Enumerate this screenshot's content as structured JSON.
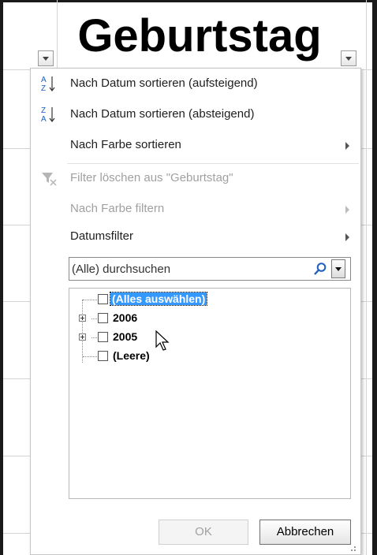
{
  "header": {
    "column_title": "Geburtstag"
  },
  "menu": {
    "sort_asc": "Nach Datum sortieren (aufsteigend)",
    "sort_desc": "Nach Datum sortieren (absteigend)",
    "sort_by_color": "Nach Farbe sortieren",
    "clear_filter": "Filter löschen aus \"Geburtstag\"",
    "filter_by_color": "Nach Farbe filtern",
    "date_filter": "Datumsfilter"
  },
  "search": {
    "value": "(Alle) durchsuchen"
  },
  "tree": {
    "items": [
      {
        "label": "(Alles auswählen)",
        "selected": true,
        "expandable": false
      },
      {
        "label": "2006",
        "selected": false,
        "expandable": true
      },
      {
        "label": "2005",
        "selected": false,
        "expandable": true
      },
      {
        "label": "(Leere)",
        "selected": false,
        "expandable": false
      }
    ]
  },
  "buttons": {
    "ok": "OK",
    "cancel": "Abbrechen"
  },
  "colors": {
    "accent_green": "#217346",
    "selection_blue": "#3399ff",
    "search_icon_blue": "#1f5fbf"
  }
}
